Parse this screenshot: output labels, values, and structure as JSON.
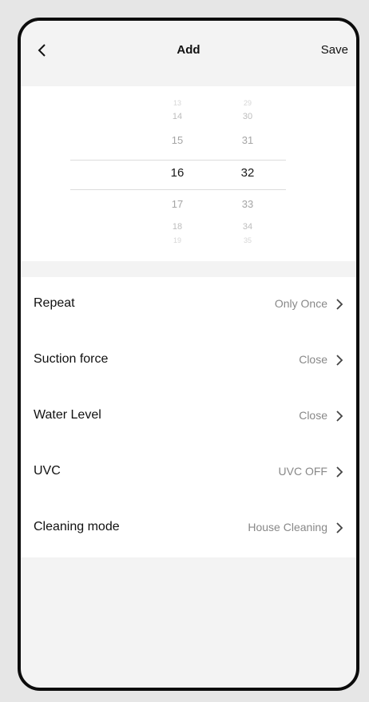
{
  "header": {
    "back_icon": "chevron-left-icon",
    "title": "Add",
    "save_label": "Save"
  },
  "time_picker": {
    "hours": [
      "13",
      "14",
      "15",
      "16",
      "17",
      "18",
      "19"
    ],
    "minutes": [
      "29",
      "30",
      "31",
      "32",
      "33",
      "34",
      "35"
    ],
    "selected_hour": "16",
    "selected_minute": "32"
  },
  "settings": [
    {
      "label": "Repeat",
      "value": "Only Once"
    },
    {
      "label": "Suction force",
      "value": "Close"
    },
    {
      "label": "Water Level",
      "value": "Close"
    },
    {
      "label": "UVC",
      "value": "UVC OFF"
    },
    {
      "label": "Cleaning mode",
      "value": "House Cleaning"
    }
  ],
  "colors": {
    "background": "#f3f3f3",
    "card": "#ffffff",
    "text": "#111111",
    "muted": "#888888"
  }
}
